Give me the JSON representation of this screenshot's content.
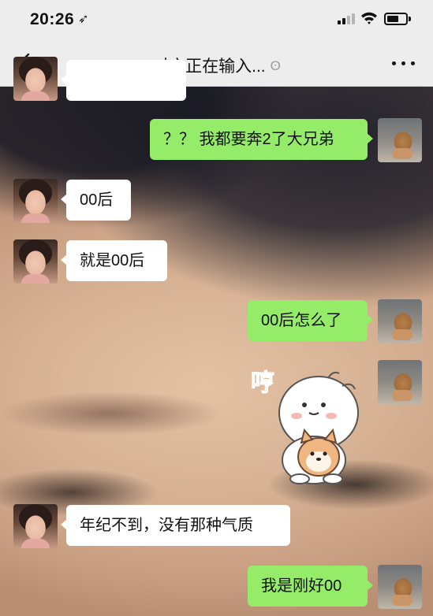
{
  "status_bar": {
    "time": "20:26",
    "location_arrow": "➶",
    "icons": [
      "cellular-signal-icon",
      "wifi-icon",
      "battery-icon"
    ]
  },
  "nav_bar": {
    "back_icon": "chevron-left-icon",
    "title": "对方正在输入...",
    "title_icon": "ear-icon",
    "more_icon": "more-dots-icon"
  },
  "messages": [
    {
      "side": "left",
      "text": "",
      "partial": true
    },
    {
      "side": "right",
      "text": "？？ 我都要奔2了大兄弟"
    },
    {
      "side": "left",
      "text": "00后"
    },
    {
      "side": "left",
      "text": "就是00后"
    },
    {
      "side": "right",
      "text": "00后怎么了"
    },
    {
      "side": "right",
      "type": "sticker",
      "sticker_text": "哼"
    },
    {
      "side": "left",
      "text": "年纪不到，没有那种气质"
    },
    {
      "side": "right",
      "text": "我是刚好00"
    }
  ],
  "colors": {
    "bar_background": "#ededed",
    "bubble_outgoing": "#95ec69",
    "bubble_incoming": "#ffffff",
    "sticker_text": "#e85a3a"
  }
}
